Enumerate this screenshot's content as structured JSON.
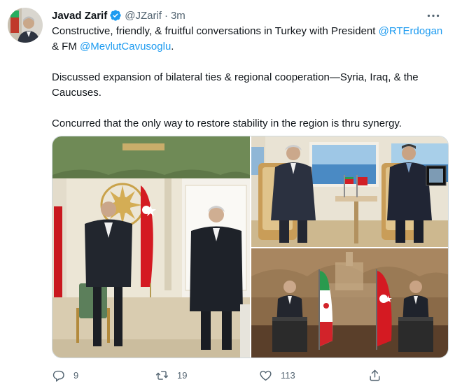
{
  "tweet": {
    "author_name": "Javad Zarif",
    "handle": "@JZarif",
    "separator": "·",
    "time": "3m",
    "paragraph1_start": "Constructive, friendly, & fruitful conversations in Turkey with President ",
    "mention1": "@RTErdogan",
    "paragraph1_mid": " & FM ",
    "mention2": "@MevlutCavusoglu",
    "paragraph1_end": ".",
    "paragraph2": "Discussed expansion of bilateral ties & regional cooperation—Syria, Iraq, & the Caucuses.",
    "paragraph3": "Concurred that the only way to restore stability in the region is thru synergy."
  },
  "actions": {
    "reply_count": "9",
    "retweet_count": "19",
    "like_count": "113"
  },
  "icons": {
    "verified": "verified-badge-icon",
    "more": "more-options-icon",
    "reply": "reply-icon",
    "retweet": "retweet-icon",
    "like": "heart-icon",
    "share": "share-icon"
  },
  "colors": {
    "link": "#1d9bf0",
    "secondary_text": "#536471",
    "primary_text": "#0f1419",
    "verified": "#1d9bf0"
  }
}
